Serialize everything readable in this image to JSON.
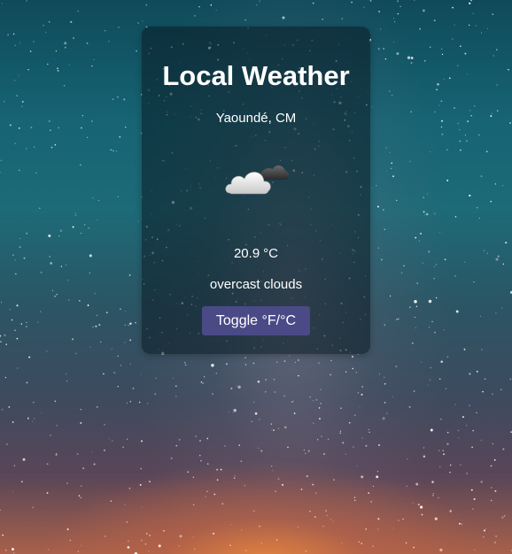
{
  "app": {
    "title": "Local Weather"
  },
  "weather": {
    "location": "Yaoundé, CM",
    "temperature": "20.9",
    "unit": "°C",
    "description": "overcast clouds",
    "icon": "overcast-clouds-icon"
  },
  "controls": {
    "toggle_label": "Toggle °F/°C"
  },
  "colors": {
    "button": "#4a4a87",
    "card": "rgba(10, 25, 35, 0.55)",
    "text": "#ffffff"
  }
}
